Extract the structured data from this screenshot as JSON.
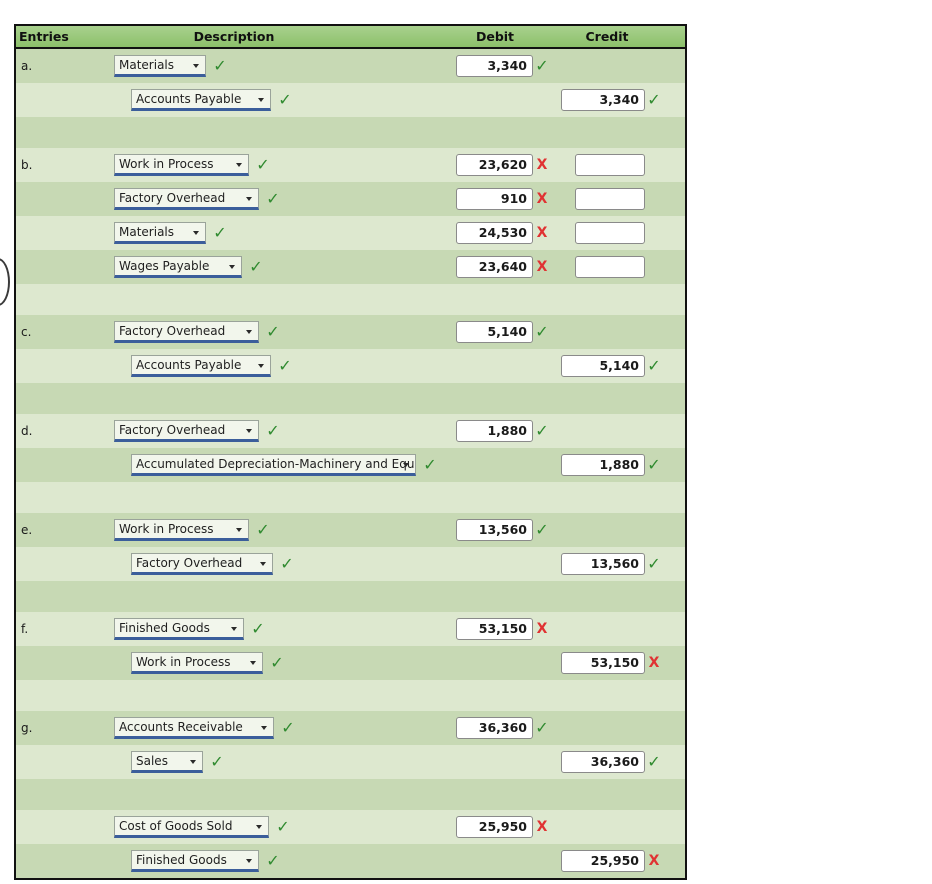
{
  "header": {
    "entries": "Entries",
    "description": "Description",
    "debit": "Debit",
    "credit": "Credit"
  },
  "colors": {
    "header_green_top": "#a9d18e",
    "header_green_bottom": "#8cc06a",
    "row_light": "#dde8cf",
    "row_dark": "#c7d9b4",
    "select_underline_blue": "#3b5e9b",
    "check_green": "#2f8a2f",
    "cross_red": "#e03232"
  },
  "icons": {
    "check": "✓",
    "cross": "X",
    "caret": "caret-down-icon"
  },
  "rows": [
    {
      "kind": "entry",
      "shade": "dark",
      "letter": "a.",
      "account": "Materials",
      "indent": 1,
      "acct_width": 92,
      "acct_mark": "ok",
      "debit": "3,340",
      "debit_mark": "ok",
      "credit": "",
      "credit_mark": "none",
      "credit_blank": false
    },
    {
      "kind": "entry",
      "shade": "light",
      "letter": "",
      "account": "Accounts Payable",
      "indent": 2,
      "acct_width": 140,
      "acct_mark": "ok",
      "debit": "",
      "debit_mark": "none",
      "credit": "3,340",
      "credit_mark": "ok",
      "credit_blank": false
    },
    {
      "kind": "spacer",
      "shade": "dark"
    },
    {
      "kind": "entry",
      "shade": "light",
      "letter": "b.",
      "account": "Work in Process",
      "indent": 1,
      "acct_width": 135,
      "acct_mark": "ok",
      "debit": "23,620",
      "debit_mark": "bad",
      "credit": "",
      "credit_mark": "none",
      "credit_blank": true
    },
    {
      "kind": "entry",
      "shade": "dark",
      "letter": "",
      "account": "Factory Overhead",
      "indent": 1,
      "acct_width": 145,
      "acct_mark": "ok",
      "debit": "910",
      "debit_mark": "bad",
      "credit": "",
      "credit_mark": "none",
      "credit_blank": true
    },
    {
      "kind": "entry",
      "shade": "light",
      "letter": "",
      "account": "Materials",
      "indent": 1,
      "acct_width": 92,
      "acct_mark": "ok",
      "debit": "24,530",
      "debit_mark": "bad",
      "credit": "",
      "credit_mark": "none",
      "credit_blank": true
    },
    {
      "kind": "entry",
      "shade": "dark",
      "letter": "",
      "account": "Wages Payable",
      "indent": 1,
      "acct_width": 128,
      "acct_mark": "ok",
      "debit": "23,640",
      "debit_mark": "bad",
      "credit": "",
      "credit_mark": "none",
      "credit_blank": true
    },
    {
      "kind": "spacer",
      "shade": "light"
    },
    {
      "kind": "entry",
      "shade": "dark",
      "letter": "c.",
      "account": "Factory Overhead",
      "indent": 1,
      "acct_width": 145,
      "acct_mark": "ok",
      "debit": "5,140",
      "debit_mark": "ok",
      "credit": "",
      "credit_mark": "none",
      "credit_blank": false
    },
    {
      "kind": "entry",
      "shade": "light",
      "letter": "",
      "account": "Accounts Payable",
      "indent": 2,
      "acct_width": 140,
      "acct_mark": "ok",
      "debit": "",
      "debit_mark": "none",
      "credit": "5,140",
      "credit_mark": "ok",
      "credit_blank": false
    },
    {
      "kind": "spacer",
      "shade": "dark"
    },
    {
      "kind": "entry",
      "shade": "light",
      "letter": "d.",
      "account": "Factory Overhead",
      "indent": 1,
      "acct_width": 145,
      "acct_mark": "ok",
      "debit": "1,880",
      "debit_mark": "ok",
      "credit": "",
      "credit_mark": "none",
      "credit_blank": false
    },
    {
      "kind": "entry",
      "shade": "dark",
      "letter": "",
      "account": "Accumulated Depreciation-Machinery and Equipment",
      "indent": 2,
      "acct_width": 357,
      "acct_mark": "ok",
      "debit": "",
      "debit_mark": "none",
      "credit": "1,880",
      "credit_mark": "ok",
      "credit_blank": false
    },
    {
      "kind": "spacer",
      "shade": "light"
    },
    {
      "kind": "entry",
      "shade": "dark",
      "letter": "e.",
      "account": "Work in Process",
      "indent": 1,
      "acct_width": 135,
      "acct_mark": "ok",
      "debit": "13,560",
      "debit_mark": "ok",
      "credit": "",
      "credit_mark": "none",
      "credit_blank": false
    },
    {
      "kind": "entry",
      "shade": "light",
      "letter": "",
      "account": "Factory Overhead",
      "indent": 2,
      "acct_width": 142,
      "acct_mark": "ok",
      "debit": "",
      "debit_mark": "none",
      "credit": "13,560",
      "credit_mark": "ok",
      "credit_blank": false
    },
    {
      "kind": "spacer",
      "shade": "dark"
    },
    {
      "kind": "entry",
      "shade": "light",
      "letter": "f.",
      "account": "Finished Goods",
      "indent": 1,
      "acct_width": 130,
      "acct_mark": "ok",
      "debit": "53,150",
      "debit_mark": "bad",
      "credit": "",
      "credit_mark": "none",
      "credit_blank": false
    },
    {
      "kind": "entry",
      "shade": "dark",
      "letter": "",
      "account": "Work in Process",
      "indent": 2,
      "acct_width": 132,
      "acct_mark": "ok",
      "debit": "",
      "debit_mark": "none",
      "credit": "53,150",
      "credit_mark": "bad",
      "credit_blank": false
    },
    {
      "kind": "spacer",
      "shade": "light"
    },
    {
      "kind": "entry",
      "shade": "dark",
      "letter": "g.",
      "account": "Accounts Receivable",
      "indent": 1,
      "acct_width": 160,
      "acct_mark": "ok",
      "debit": "36,360",
      "debit_mark": "ok",
      "credit": "",
      "credit_mark": "none",
      "credit_blank": false
    },
    {
      "kind": "entry",
      "shade": "light",
      "letter": "",
      "account": "Sales",
      "indent": 2,
      "acct_width": 72,
      "acct_mark": "ok",
      "debit": "",
      "debit_mark": "none",
      "credit": "36,360",
      "credit_mark": "ok",
      "credit_blank": false
    },
    {
      "kind": "spacer",
      "shade": "dark"
    },
    {
      "kind": "entry",
      "shade": "light",
      "letter": "",
      "account": "Cost of Goods Sold",
      "indent": 1,
      "acct_width": 155,
      "acct_mark": "ok",
      "debit": "25,950",
      "debit_mark": "bad",
      "credit": "",
      "credit_mark": "none",
      "credit_blank": false
    },
    {
      "kind": "entry",
      "shade": "dark",
      "letter": "",
      "account": "Finished Goods",
      "indent": 2,
      "acct_width": 128,
      "acct_mark": "ok",
      "debit": "",
      "debit_mark": "none",
      "credit": "25,950",
      "credit_mark": "bad",
      "credit_blank": false
    }
  ]
}
